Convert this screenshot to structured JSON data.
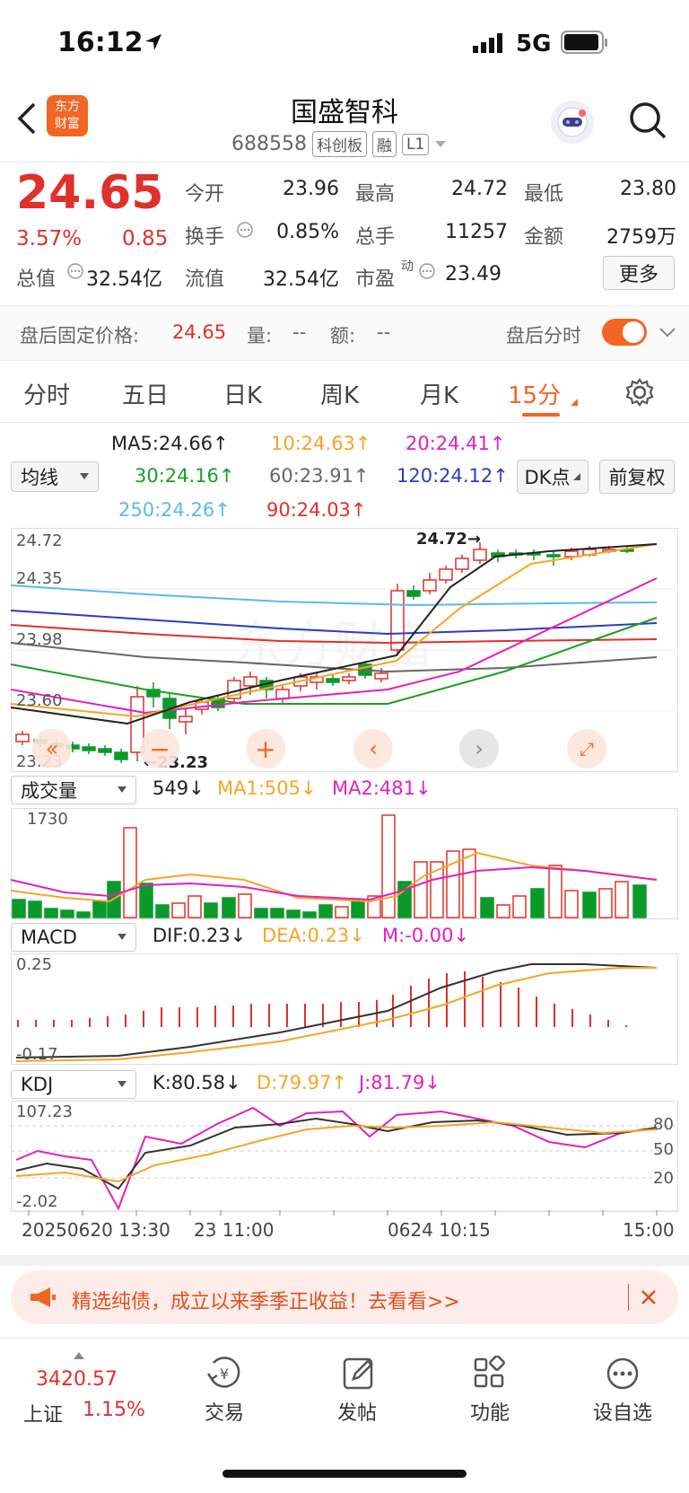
{
  "status": {
    "time": "16:12",
    "network": "5G"
  },
  "stock": {
    "name": "国盛智科",
    "code": "688558",
    "tags": [
      "科创板",
      "融",
      "L1"
    ],
    "price": "24.65",
    "change_pct": "3.57%",
    "change": "0.85"
  },
  "quote_grid": [
    {
      "label": "今开",
      "value": "23.96",
      "color": "red"
    },
    {
      "label": "最高",
      "value": "24.72",
      "color": "red"
    },
    {
      "label": "最低",
      "value": "23.80",
      "color": "black"
    },
    {
      "label": "换手",
      "value": "0.85%",
      "color": "black"
    },
    {
      "label": "总手",
      "value": "11257",
      "color": "black"
    },
    {
      "label": "金额",
      "value": "2759万",
      "color": "black"
    },
    {
      "label": "总值",
      "value": "32.54亿",
      "color": "black"
    },
    {
      "label": "流值",
      "value": "32.54亿",
      "color": "black"
    },
    {
      "label": "市盈",
      "value": "23.49",
      "color": "black"
    }
  ],
  "pe_superscript": "动",
  "more_label": "更多",
  "after_hours": {
    "label": "盘后固定价格:",
    "price": "24.65",
    "vol_label": "量:",
    "vol": "--",
    "amt_label": "额:",
    "amt": "--",
    "toggle_label": "盘后分时"
  },
  "tabs": [
    "分时",
    "五日",
    "日K",
    "周K",
    "月K",
    "15分"
  ],
  "active_tab": "15分",
  "ma_select": "均线",
  "ma_values": [
    {
      "label": "MA5:24.66↑",
      "color": "#222"
    },
    {
      "label": "10:24.63↑",
      "color": "#f5a623"
    },
    {
      "label": "20:24.41↑",
      "color": "#e020c0"
    },
    {
      "label": "30:24.16↑",
      "color": "#1aa020"
    },
    {
      "label": "60:23.91↑",
      "color": "#666666"
    },
    {
      "label": "120:24.12↑",
      "color": "#2a3cc0"
    },
    {
      "label": "250:24.26↑",
      "color": "#5bb8f0"
    },
    {
      "label": "90:24.03↑",
      "color": "#e0302a"
    }
  ],
  "dk_label": "DK点",
  "adjust_label": "前复权",
  "kline_axis": [
    "24.72",
    "24.35",
    "23.98",
    "23.60",
    "23.23"
  ],
  "kline_high_label": "24.72→",
  "kline_low_label": "←23.23",
  "volume": {
    "select": "成交量",
    "value": "549↓",
    "ma1": "MA1:505↓",
    "ma2": "MA2:481↓",
    "axis_top": "1730"
  },
  "macd": {
    "select": "MACD",
    "dif": "DIF:0.23↓",
    "dea": "DEA:0.23↓",
    "m": "M:-0.00↓",
    "axis_top": "0.25",
    "axis_bottom": "-0.17"
  },
  "kdj": {
    "select": "KDJ",
    "k": "K:80.58↓",
    "d": "D:79.97↑",
    "j": "J:81.79↓",
    "axis_top": "107.23",
    "axis_bottom": "-2.02",
    "levels": [
      "80",
      "50",
      "20"
    ]
  },
  "time_axis": [
    "20250620 13:30",
    "23 11:00",
    "0624 10:15",
    "15:00"
  ],
  "banner_text": "精选纯债，成立以来季季正收益！去看看>>",
  "bottom_nav": [
    {
      "label": "上证",
      "value": "3420.57",
      "pct": "1.15%"
    },
    {
      "label": "交易"
    },
    {
      "label": "发帖"
    },
    {
      "label": "功能"
    },
    {
      "label": "设自选"
    }
  ],
  "colors": {
    "red": "#e0302a",
    "green": "#0a9a2a",
    "orange": "#f5a623",
    "magenta": "#e020c0"
  }
}
